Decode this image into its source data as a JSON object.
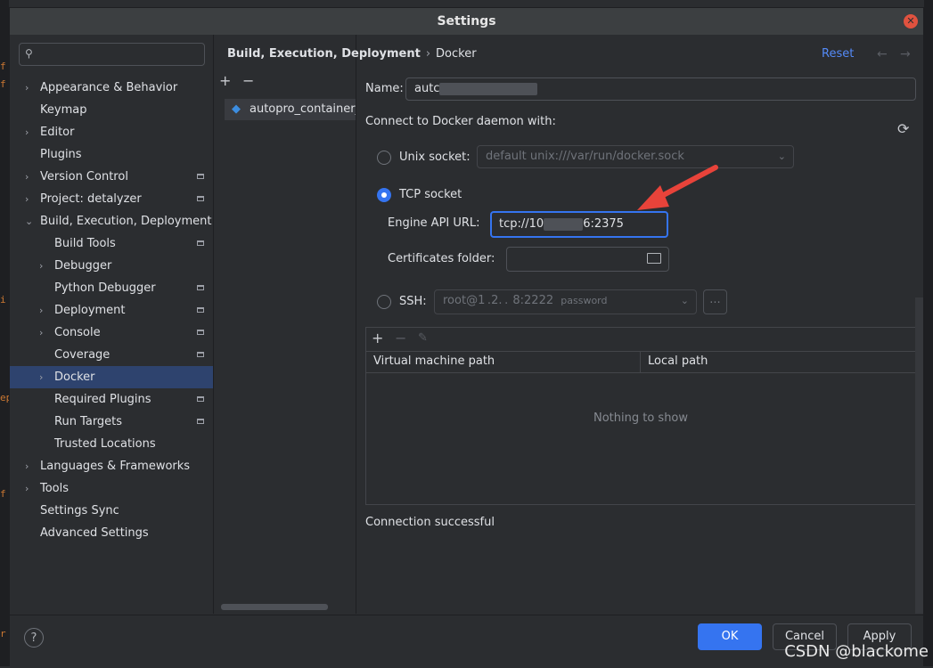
{
  "window": {
    "title": "Settings"
  },
  "search": {
    "placeholder": ""
  },
  "sidebar": {
    "items": [
      {
        "label": "Appearance & Behavior",
        "level": 0,
        "expandable": true,
        "expanded": false,
        "project": false
      },
      {
        "label": "Keymap",
        "level": 0,
        "expandable": false,
        "project": false
      },
      {
        "label": "Editor",
        "level": 0,
        "expandable": true,
        "expanded": false,
        "project": false
      },
      {
        "label": "Plugins",
        "level": 0,
        "expandable": false,
        "project": false
      },
      {
        "label": "Version Control",
        "level": 0,
        "expandable": true,
        "expanded": false,
        "project": true
      },
      {
        "label": "Project: detalyzer",
        "level": 0,
        "expandable": true,
        "expanded": false,
        "project": true
      },
      {
        "label": "Build, Execution, Deployment",
        "level": 0,
        "expandable": true,
        "expanded": true,
        "project": false
      },
      {
        "label": "Build Tools",
        "level": 1,
        "expandable": false,
        "project": true
      },
      {
        "label": "Debugger",
        "level": 1,
        "expandable": true,
        "expanded": false,
        "project": false
      },
      {
        "label": "Python Debugger",
        "level": 1,
        "expandable": false,
        "project": true
      },
      {
        "label": "Deployment",
        "level": 1,
        "expandable": true,
        "expanded": false,
        "project": true
      },
      {
        "label": "Console",
        "level": 1,
        "expandable": true,
        "expanded": false,
        "project": true
      },
      {
        "label": "Coverage",
        "level": 1,
        "expandable": false,
        "project": true
      },
      {
        "label": "Docker",
        "level": 1,
        "expandable": true,
        "expanded": false,
        "project": false,
        "selected": true
      },
      {
        "label": "Required Plugins",
        "level": 1,
        "expandable": false,
        "project": true
      },
      {
        "label": "Run Targets",
        "level": 1,
        "expandable": false,
        "project": true
      },
      {
        "label": "Trusted Locations",
        "level": 1,
        "expandable": false,
        "project": false
      },
      {
        "label": "Languages & Frameworks",
        "level": 0,
        "expandable": true,
        "expanded": false,
        "project": false
      },
      {
        "label": "Tools",
        "level": 0,
        "expandable": true,
        "expanded": false,
        "project": false
      },
      {
        "label": "Settings Sync",
        "level": 0,
        "expandable": false,
        "project": false
      },
      {
        "label": "Advanced Settings",
        "level": 0,
        "expandable": false,
        "project": false
      }
    ]
  },
  "middle": {
    "add_icon": "+",
    "remove_icon": "−",
    "entry_label": "autopro_container_"
  },
  "header": {
    "breadcrumb_parent": "Build, Execution, Deployment",
    "breadcrumb_separator": "›",
    "breadcrumb_leaf": "Docker",
    "reset_label": "Reset",
    "back_icon": "←",
    "forward_icon": "→"
  },
  "docker": {
    "name_label": "Name:",
    "name_value": "autc",
    "connect_label": "Connect to Docker daemon with:",
    "unix_label": "Unix socket:",
    "unix_value": "default  unix:///var/run/docker.sock",
    "unix_selected": false,
    "tcp_label": "TCP socket",
    "tcp_selected": true,
    "engine_label": "Engine API URL:",
    "engine_prefix": "tcp://10",
    "engine_suffix": "6:2375",
    "cert_label": "Certificates folder:",
    "cert_value": "",
    "ssh_label": "SSH:",
    "ssh_value": "root@1 .2. .  8:2222",
    "ssh_suffix": "password",
    "ssh_selected": false,
    "ssh_more": "...",
    "table": {
      "add_icon": "+",
      "remove_icon": "−",
      "edit_icon": "✎",
      "columns": [
        "Virtual machine path",
        "Local path"
      ],
      "empty_text": "Nothing to show"
    },
    "status": "Connection successful"
  },
  "footer": {
    "help_label": "?",
    "ok_label": "OK",
    "cancel_label": "Cancel",
    "apply_label": "Apply"
  },
  "watermark": "CSDN @blackome",
  "colors": {
    "accent": "#3574f0",
    "selection": "#2e436e",
    "annotation_arrow": "#e8433a",
    "link": "#548af7"
  }
}
